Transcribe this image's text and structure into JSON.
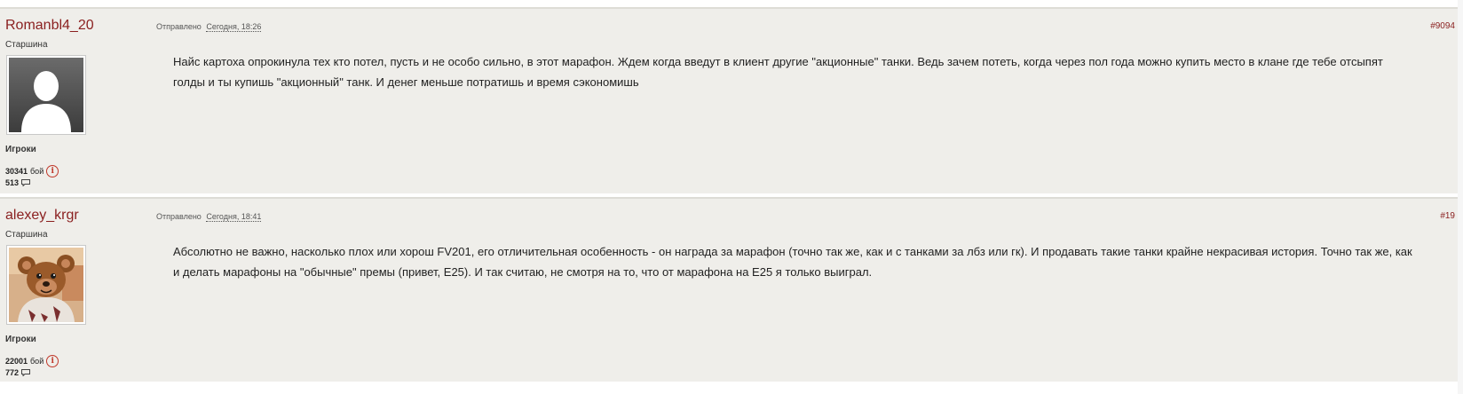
{
  "posts": [
    {
      "username": "Romanbl4_20",
      "rank": "Старшина",
      "group": "Игроки",
      "battles_count": "30341",
      "battles_label": "бой",
      "messages_count": "513",
      "sent_label": "Отправлено",
      "date": "Сегодня, 18:26",
      "post_number": "#9094",
      "avatar": "default-silhouette",
      "text": "Найс картоха опрокинула тех кто потел, пусть и не особо сильно, в этот марафон. Ждем когда введут в клиент другие \"акционные\" танки. Ведь зачем потеть, когда через пол года можно купить место в клане где тебе отсыпят голды и ты купишь \"акционный\" танк. И денег меньше потратишь и время сэкономишь"
    },
    {
      "username": "alexey_krgr",
      "rank": "Старшина",
      "group": "Игроки",
      "battles_count": "22001",
      "battles_label": "бой",
      "messages_count": "772",
      "sent_label": "Отправлено",
      "date": "Сегодня, 18:41",
      "post_number": "#19",
      "avatar": "puppet-character",
      "text": "Абсолютно не важно, насколько плох или хорош FV201, его отличительная особенность - он награда за марафон (точно так же, как и с танками за лбз или гк). И продавать такие танки крайне некрасивая история. Точно так же, как и делать марафоны на \"обычные\" премы (привет, E25). И так считаю, не смотря на то, что от марафона на E25 я только выиграл."
    }
  ],
  "colors": {
    "username": "#8a1f1f",
    "post_background": "#efeeea",
    "info_icon": "#c0392b"
  }
}
